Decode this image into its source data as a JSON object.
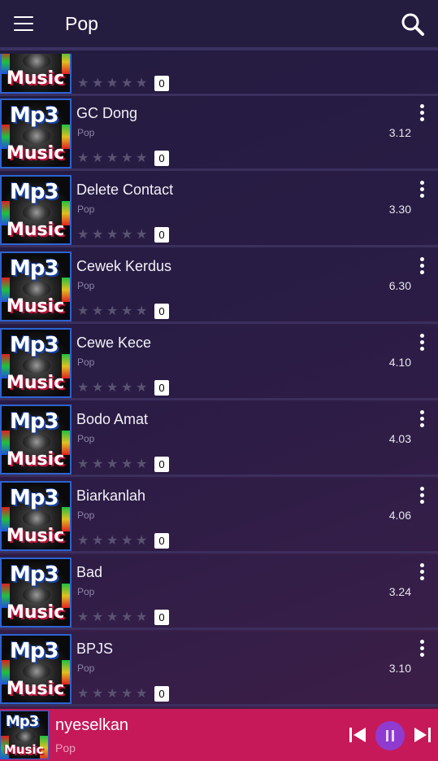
{
  "appbar": {
    "title": "Pop",
    "menu_icon": "hamburger-menu-icon",
    "search_icon": "search-icon"
  },
  "thumbnail": {
    "line1": "Mp3",
    "line2": "Music"
  },
  "songs": [
    {
      "title": "",
      "genre": "",
      "duration": "",
      "rating_count": "0"
    },
    {
      "title": "GC Dong",
      "genre": "Pop",
      "duration": "3.12",
      "rating_count": "0"
    },
    {
      "title": "Delete Contact",
      "genre": "Pop",
      "duration": "3.30",
      "rating_count": "0"
    },
    {
      "title": "Cewek Kerdus",
      "genre": "Pop",
      "duration": "6.30",
      "rating_count": "0"
    },
    {
      "title": "Cewe Kece",
      "genre": "Pop",
      "duration": "4.10",
      "rating_count": "0"
    },
    {
      "title": "Bodo Amat",
      "genre": "Pop",
      "duration": "4.03",
      "rating_count": "0"
    },
    {
      "title": "Biarkanlah",
      "genre": "Pop",
      "duration": "4.06",
      "rating_count": "0"
    },
    {
      "title": "Bad",
      "genre": "Pop",
      "duration": "3.24",
      "rating_count": "0"
    },
    {
      "title": "BPJS",
      "genre": "Pop",
      "duration": "3.10",
      "rating_count": "0"
    }
  ],
  "player": {
    "title": "nyeselkan",
    "genre": "Pop",
    "state": "playing",
    "icons": [
      "skip-previous-icon",
      "pause-icon",
      "skip-next-icon"
    ]
  },
  "colors": {
    "appbar": "#251d40",
    "player_bar": "#c6195a",
    "pause_button": "#8f3bd0",
    "star_empty": "#5a5272"
  }
}
